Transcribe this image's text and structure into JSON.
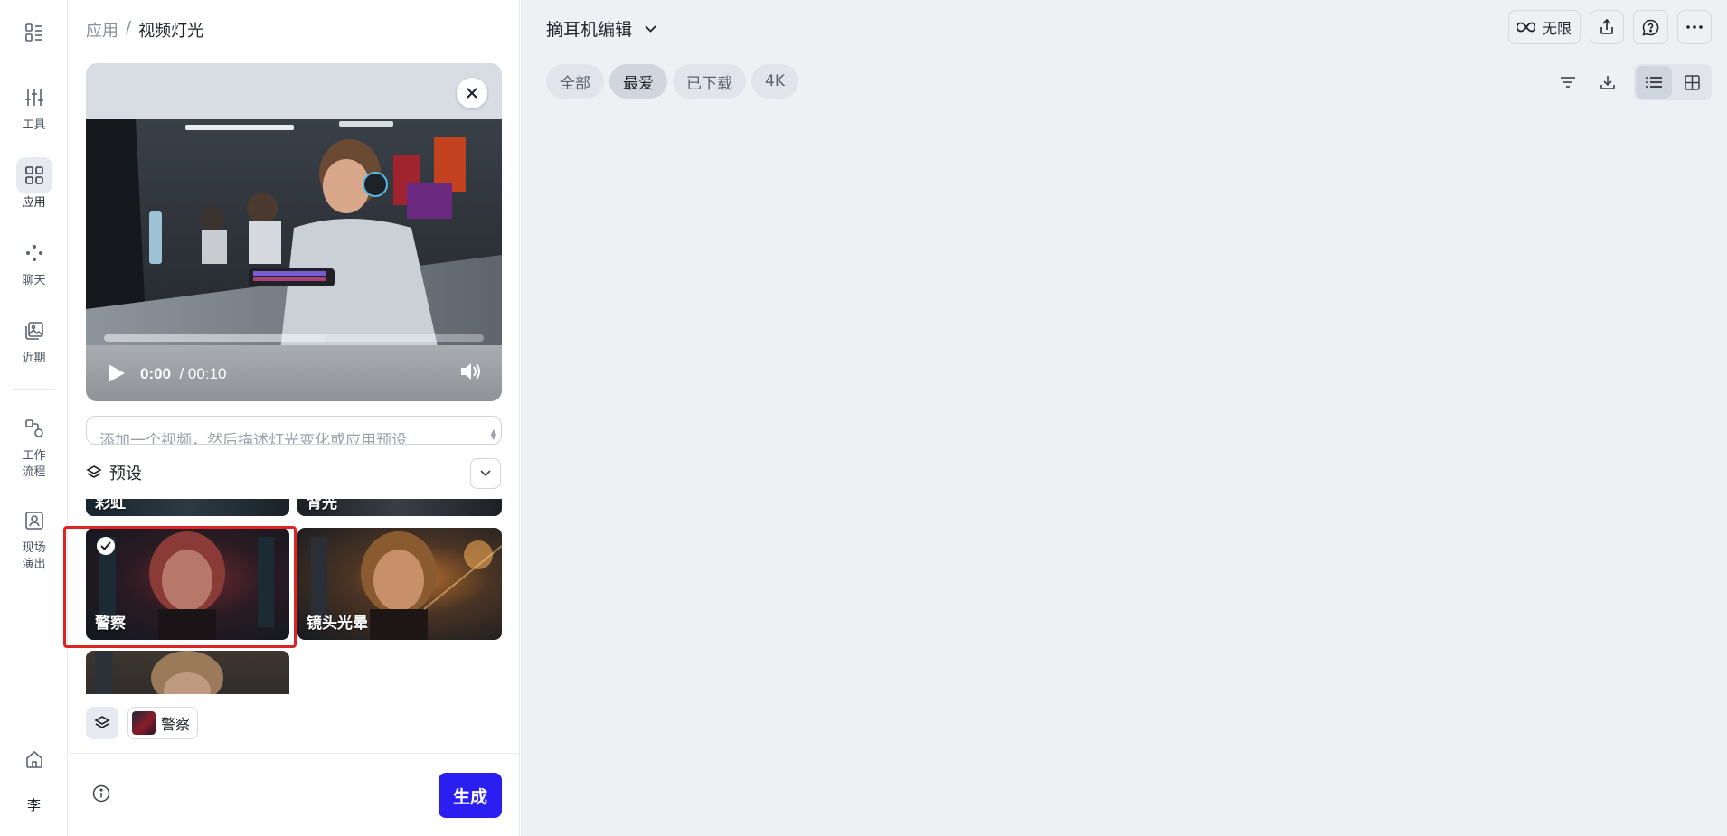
{
  "rail": {
    "tools_label": "工具",
    "apps_label": "应用",
    "chat_label": "聊天",
    "recent_label": "近期",
    "workflow_label": "工作\n流程",
    "live_label": "现场\n演出",
    "avatar": "李"
  },
  "panel": {
    "breadcrumb_parent": "应用",
    "breadcrumb_sep": "/",
    "breadcrumb_current": "视频灯光",
    "video": {
      "current_time": "0:00",
      "duration": "/ 00:10",
      "progress_fraction": 0.0
    },
    "prompt_placeholder": "添加一个视频，然后描述灯光变化或应用预设",
    "preset_title": "预设",
    "presets": [
      {
        "name": "彩虹"
      },
      {
        "name": "背光"
      },
      {
        "name": "警察",
        "selected": true
      },
      {
        "name": "镜头光晕"
      },
      {
        "name": ""
      }
    ],
    "selected_chip_label": "警察",
    "generate_label": "生成"
  },
  "main": {
    "project_title": "摘耳机编辑",
    "tabs": [
      "全部",
      "最爱",
      "已下载",
      "4K"
    ],
    "active_tab": "最爱",
    "unlimited_label": "无限"
  },
  "colors": {
    "accent": "#2a1ff0",
    "selection": "#e02424",
    "background": "#eef0f4"
  }
}
